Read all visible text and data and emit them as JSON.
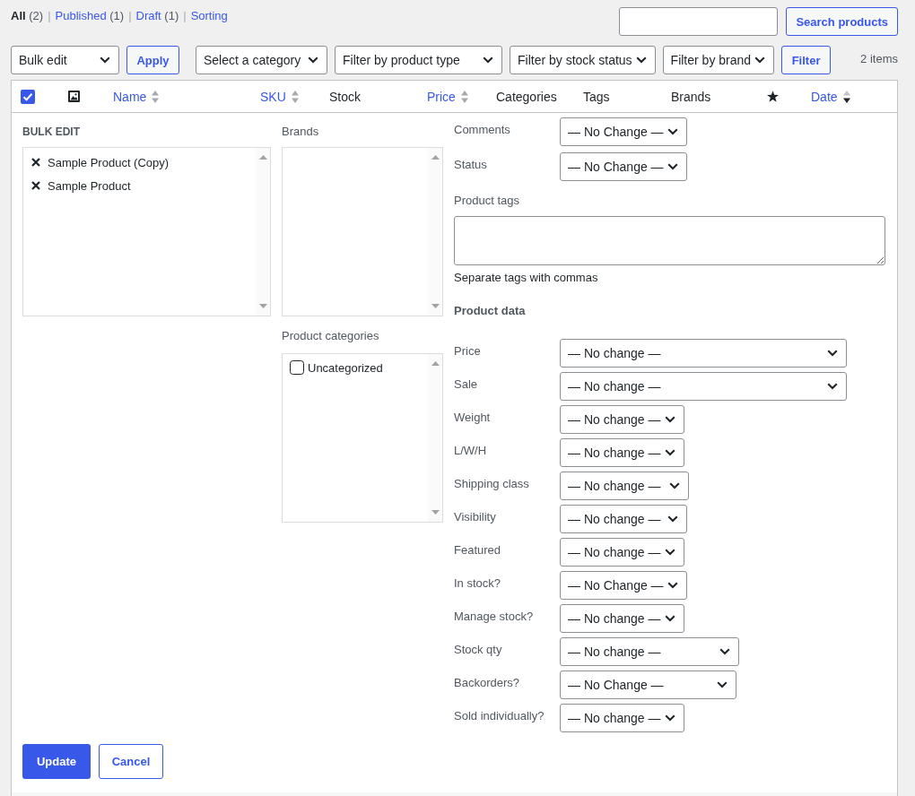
{
  "status_filter": {
    "separator": "|",
    "links": [
      {
        "label": "All",
        "count": "(2)",
        "selected": true
      },
      {
        "label": "Published",
        "count": "(1)",
        "selected": false
      },
      {
        "label": "Draft",
        "count": "(1)",
        "selected": false
      },
      {
        "label": "Sorting",
        "selected": false
      }
    ]
  },
  "search": {
    "button": "Search products"
  },
  "toolbar": {
    "bulk_action": {
      "value": "Bulk edit"
    },
    "apply_button": "Apply",
    "filters": [
      {
        "value": "Select a category"
      },
      {
        "value": "Filter by product type"
      },
      {
        "value": "Filter by stock status"
      },
      {
        "value": "Filter by brand"
      }
    ],
    "filter_button": "Filter",
    "item_count": "2 items"
  },
  "table": {
    "columns": [
      {
        "kind": "checkbox",
        "checked": true
      },
      {
        "kind": "image"
      },
      {
        "kind": "sortable",
        "label": "Name",
        "sorted": false
      },
      {
        "kind": "sortable",
        "label": "SKU",
        "sorted": false
      },
      {
        "kind": "text",
        "label": "Stock"
      },
      {
        "kind": "sortable",
        "label": "Price",
        "sorted": false
      },
      {
        "kind": "text",
        "label": "Categories"
      },
      {
        "kind": "text",
        "label": "Tags"
      },
      {
        "kind": "text",
        "label": "Brands"
      },
      {
        "kind": "star"
      },
      {
        "kind": "sortable",
        "label": "Date",
        "sorted": true
      }
    ]
  },
  "bulk_edit": {
    "title": "BULK EDIT",
    "products": [
      "Sample Product (Copy)",
      "Sample Product"
    ],
    "brands": {
      "label": "Brands"
    },
    "categories": {
      "label": "Product categories",
      "items": [
        {
          "label": "Uncategorized",
          "checked": false
        }
      ]
    },
    "comments": {
      "label": "Comments",
      "value": "— No Change —"
    },
    "status": {
      "label": "Status",
      "value": "— No Change —"
    },
    "tags": {
      "label": "Product tags",
      "hint": "Separate tags with commas"
    },
    "product_data": {
      "heading": "Product data",
      "fields": [
        {
          "label": "Price",
          "value": "— No change —"
        },
        {
          "label": "Sale",
          "value": "— No change —"
        },
        {
          "label": "Weight",
          "value": "— No change —"
        },
        {
          "label": "L/W/H",
          "value": "— No change —"
        },
        {
          "label": "Shipping class",
          "value": "— No change —"
        },
        {
          "label": "Visibility",
          "value": "— No change —"
        },
        {
          "label": "Featured",
          "value": "— No change —"
        },
        {
          "label": "In stock?",
          "value": "— No Change —"
        },
        {
          "label": "Manage stock?",
          "value": "— No change —"
        },
        {
          "label": "Stock qty",
          "value": "— No change —"
        },
        {
          "label": "Backorders?",
          "value": "— No Change —"
        },
        {
          "label": "Sold individually?",
          "value": "— No change —"
        }
      ]
    },
    "buttons": {
      "update": "Update",
      "cancel": "Cancel"
    }
  }
}
